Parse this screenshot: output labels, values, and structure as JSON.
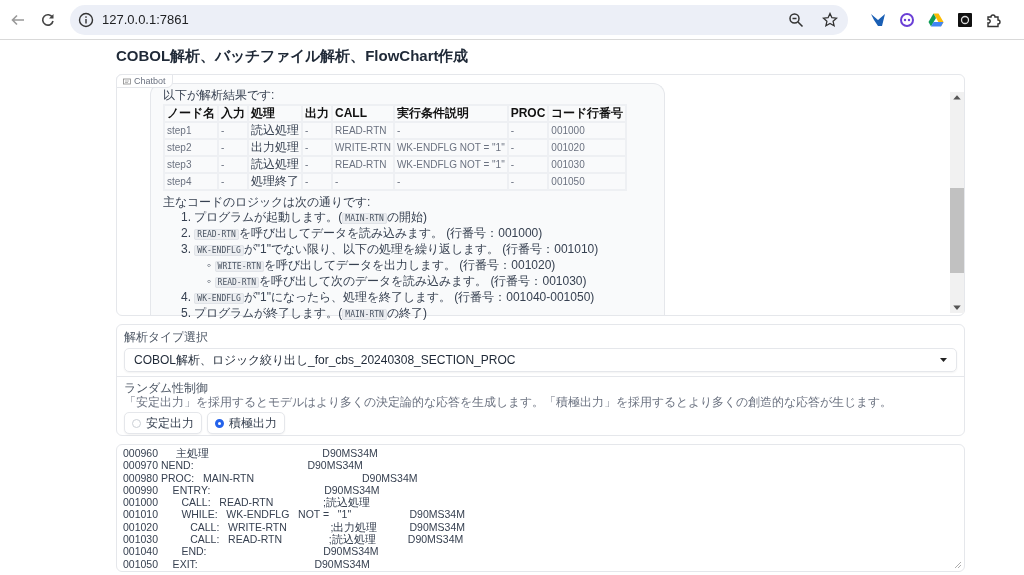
{
  "browser": {
    "url": "127.0.0.1:7861"
  },
  "page_title": "COBOL解析、バッチファイル解析、FlowChart作成",
  "chatbot": {
    "label": "Chatbot",
    "message": {
      "intro": "以下が解析結果です:",
      "table": {
        "columns": [
          "ノード名",
          "入力",
          "処理",
          "出力",
          "CALL",
          "実行条件説明",
          "PROC",
          "コード行番号"
        ],
        "rows": [
          [
            "step1",
            "-",
            "読込処理",
            "-",
            "READ-RTN",
            "-",
            "-",
            "001000"
          ],
          [
            "step2",
            "-",
            "出力処理",
            "-",
            "WRITE-RTN",
            "WK-ENDFLG NOT = \"1\"",
            "-",
            "001020"
          ],
          [
            "step3",
            "-",
            "読込処理",
            "-",
            "READ-RTN",
            "WK-ENDFLG NOT = \"1\"",
            "-",
            "001030"
          ],
          [
            "step4",
            "-",
            "処理終了",
            "-",
            "-",
            "-",
            "-",
            "001050"
          ]
        ]
      },
      "summary": "主なコードのロジックは次の通りです:",
      "steps": [
        {
          "marker": "1.",
          "parts": [
            {
              "kind": "text",
              "text": "プログラムが起動します。("
            },
            {
              "kind": "code",
              "text": "MAIN-RTN"
            },
            {
              "kind": "text",
              "text": "の開始)"
            }
          ]
        },
        {
          "marker": "2.",
          "parts": [
            {
              "kind": "code",
              "text": "READ-RTN"
            },
            {
              "kind": "text",
              "text": "を呼び出してデータを読み込みます。 (行番号：001000)"
            }
          ]
        },
        {
          "marker": "3.",
          "parts": [
            {
              "kind": "code",
              "text": "WK-ENDFLG"
            },
            {
              "kind": "text",
              "text": "が\"1\"でない限り、以下の処理を繰り返します。 (行番号：001010)"
            }
          ],
          "children": [
            {
              "marker": "◦",
              "parts": [
                {
                  "kind": "code",
                  "text": "WRITE-RTN"
                },
                {
                  "kind": "text",
                  "text": "を呼び出してデータを出力します。 (行番号：001020)"
                }
              ]
            },
            {
              "marker": "◦",
              "parts": [
                {
                  "kind": "code",
                  "text": "READ-RTN"
                },
                {
                  "kind": "text",
                  "text": "を呼び出して次のデータを読み込みます。 (行番号：001030)"
                }
              ]
            }
          ]
        },
        {
          "marker": "4.",
          "parts": [
            {
              "kind": "code",
              "text": "WK-ENDFLG"
            },
            {
              "kind": "text",
              "text": "が\"1\"になったら、処理を終了します。 (行番号：001040-001050)"
            }
          ]
        },
        {
          "marker": "5.",
          "parts": [
            {
              "kind": "text",
              "text": "プログラムが終了します。("
            },
            {
              "kind": "code",
              "text": "MAIN-RTN"
            },
            {
              "kind": "text",
              "text": "の終了)"
            }
          ]
        }
      ]
    }
  },
  "analysis_type": {
    "label": "解析タイプ選択",
    "value": "COBOL解析、ロジック絞り出し_for_cbs_20240308_SECTION_PROC"
  },
  "randomness": {
    "label": "ランダム性制御",
    "description": "「安定出力」を採用するとモデルはより多くの決定論的な応答を生成します。「積極出力」を採用するとより多くの創造的な応答が生じます。",
    "options": [
      {
        "label": "安定出力",
        "selected": false
      },
      {
        "label": "積極出力",
        "selected": true
      }
    ]
  },
  "code": {
    "lines": [
      "000960      主処理                                       D90MS34M",
      "000970 NEND:                                       D90MS34M",
      "000980 PROC:   MAIN-RTN                                     D90MS34M",
      "000990     ENTRY:                                       D90MS34M",
      "001000        CALL:   READ-RTN                 ;読込処理",
      "001010        WHILE:   WK-ENDFLG   NOT =   \"1\"                    D90MS34M",
      "001020           CALL:   WRITE-RTN               ;出力処理           D90MS34M",
      "001030           CALL:   READ-RTN                ;読込処理           D90MS34M",
      "001040        END:                                        D90MS34M",
      "001050     EXIT:                                        D90MS34M"
    ]
  }
}
